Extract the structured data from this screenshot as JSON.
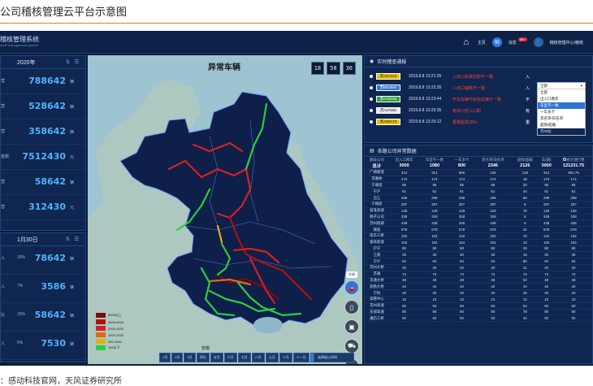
{
  "figure": {
    "title": "公司稽核管理云平台示意图",
    "source": "：感动科技官网，天风证券研究所"
  },
  "header": {
    "app_title": "稽核管理系统",
    "app_subtitle": "audit management system",
    "nav": {
      "home": "主页",
      "news": "消息",
      "news_badge": "99+",
      "user": "稽核管理中心/稽核"
    }
  },
  "year_panel": {
    "title": "2020年",
    "tools": "⇅ ☰",
    "rows": [
      {
        "label": "营",
        "value": "788642",
        "unit": "辆"
      },
      {
        "label": "营",
        "value": "528642",
        "unit": "辆"
      },
      {
        "label": "营",
        "value": "358642",
        "unit": "辆"
      },
      {
        "label": "金额",
        "value": "7512430",
        "unit": "元"
      },
      {
        "label": "营",
        "value": "58642",
        "unit": "辆"
      },
      {
        "label": "营",
        "value": "312430",
        "unit": "元"
      }
    ]
  },
  "day_panel": {
    "title": "1月30日",
    "tools": "⇅ ☰",
    "rows": [
      {
        "label": "入",
        "pct": "10%",
        "value": "78642",
        "unit": "辆"
      },
      {
        "label": "入",
        "pct": "7%",
        "value": "3586",
        "unit": "辆"
      },
      {
        "label": "比",
        "pct": "15%",
        "value": "58642",
        "unit": "辆"
      },
      {
        "label": "入",
        "pct": "5%",
        "value": "7530",
        "unit": "辆"
      }
    ]
  },
  "map": {
    "title": "异常车辆",
    "clock": [
      "18",
      "58",
      "36"
    ],
    "legend": [
      {
        "label": "8000以上",
        "color": "#7a0d0d"
      },
      {
        "label": "4000-8000",
        "color": "#b01010"
      },
      {
        "label": "2000-4000",
        "color": "#d62020"
      },
      {
        "label": "1000-2000",
        "color": "#e06a10"
      },
      {
        "label": "500-1000",
        "color": "#e6b010"
      },
      {
        "label": "100以下",
        "color": "#2ecc40"
      }
    ],
    "months": [
      "1月",
      "2月",
      "3月",
      "四月",
      "五月",
      "六月",
      "七月",
      "八月",
      "九月",
      "十月",
      "十一月",
      "十二月"
    ],
    "active_month": "十二月",
    "time_placeholder": "选择起止时间",
    "side_tag": "车辆"
  },
  "alarms": {
    "title": "实时稽查通报",
    "items": [
      {
        "plate": "苏AE3123",
        "plate_bg": "#e6c000",
        "plate_fg": "#1a1a1a",
        "time": "2019.8.8  13:21:25",
        "msg": "入出口车牌识别不一致",
        "cut": "入"
      },
      {
        "plate": "苏BE5690",
        "plate_bg": "#2f74d0",
        "plate_fg": "#ffffff",
        "time": "2019.8.8  13:22:35",
        "msg": "入出口轴数不一致",
        "cut": "入"
      },
      {
        "plate": "苏A702X5",
        "plate_bg": "#2ea043",
        "plate_fg": "#ffffff",
        "time": "2019.8.8  13:23:44",
        "msg": "不在车辆与实际车辆不一致",
        "cut": "不"
      },
      {
        "plate": "苏A27690",
        "plate_bg": "#e8e8e8",
        "plate_fg": "#1a1a1a",
        "time": "2019.8.8  13:25:35",
        "msg": "有出口无入口卸",
        "cut": "有"
      },
      {
        "plate": "苏A90A73",
        "plate_bg": "#e6c000",
        "plate_fg": "#1a1a1a",
        "time": "2019.8.8  13:26:12",
        "msg": "重量超发30%",
        "cut": "重"
      }
    ],
    "dropdown": {
      "selected": "全部",
      "options": [
        "全部",
        "出入口两年",
        "车型不一致",
        "一车多卡",
        "黑名单/白名单",
        "超限/超载"
      ],
      "highlight": "车型不一致",
      "extra": [
        "苏州站"
      ]
    }
  },
  "company": {
    "title": "各路公司异常数据",
    "headers": [
      "路段公司",
      "出入口两年",
      "车型不一致",
      "一车多卡",
      "黑名单/白名单",
      "超限/超载",
      "车(辆)",
      "统计通行费"
    ],
    "total": [
      "总计",
      "3000",
      "1080",
      "800",
      "2346",
      "2126",
      "3000",
      "121231.75"
    ],
    "rows": [
      [
        "广靖锡澄",
        "314",
        "314",
        "900",
        "245",
        "126",
        "314",
        "800.75"
      ],
      [
        "苏嘉杭",
        "174",
        "174",
        "174",
        "174",
        "18",
        "174",
        "174"
      ],
      [
        "宁通高",
        "96",
        "96",
        "96",
        "96",
        "20",
        "96",
        "96"
      ],
      [
        "宁沪",
        "61",
        "61",
        "61",
        "61",
        "44",
        "61",
        "61"
      ],
      [
        "沿江",
        "298",
        "298",
        "298",
        "298",
        "56",
        "298",
        "298"
      ],
      [
        "宁靖盐",
        "287",
        "287",
        "287",
        "287",
        "8",
        "287",
        "287"
      ],
      [
        "宿淮高速",
        "128",
        "128",
        "128",
        "128",
        "78",
        "128",
        "128"
      ],
      [
        "扬子公司",
        "328",
        "328",
        "328",
        "328",
        "5",
        "328",
        "328"
      ],
      [
        "苏州绕城",
        "438",
        "438",
        "438",
        "438",
        "6",
        "438",
        "438"
      ],
      [
        "镇淮",
        "678",
        "678",
        "678",
        "678",
        "31",
        "678",
        "678"
      ],
      [
        "南京三桥",
        "102",
        "102",
        "102",
        "102",
        "10",
        "102",
        "102"
      ],
      [
        "宿徐高速",
        "104",
        "104",
        "104",
        "104",
        "43",
        "104",
        "104"
      ],
      [
        "沪宁",
        "80",
        "80",
        "80",
        "80",
        "28",
        "80",
        "80"
      ],
      [
        "江南",
        "30",
        "30",
        "30",
        "30",
        "18",
        "30",
        "30"
      ],
      [
        "宁沪",
        "94",
        "94",
        "94",
        "94",
        "80",
        "94",
        "94"
      ],
      [
        "苏州大桥",
        "20",
        "20",
        "20",
        "20",
        "21",
        "20",
        "20"
      ],
      [
        "苏通",
        "74",
        "74",
        "74",
        "74",
        "74",
        "74",
        "74"
      ],
      [
        "京通大桥",
        "48",
        "48",
        "48",
        "48",
        "53",
        "48",
        "48"
      ],
      [
        "润扬大桥",
        "42",
        "42",
        "42",
        "42",
        "10",
        "42",
        "42"
      ],
      [
        "宁杭",
        "20",
        "20",
        "20",
        "20",
        "49",
        "20",
        "20"
      ],
      [
        "高管中心",
        "10",
        "10",
        "10",
        "10",
        "13",
        "10",
        "10"
      ],
      [
        "常州高速",
        "60",
        "60",
        "60",
        "60",
        "54",
        "60",
        "60"
      ],
      [
        "东部高速",
        "90",
        "90",
        "90",
        "90",
        "78",
        "90",
        "90"
      ],
      [
        "通启三桥",
        "92",
        "92",
        "92",
        "92",
        "42",
        "92",
        "92"
      ]
    ],
    "radio_label": "统计通行费"
  }
}
